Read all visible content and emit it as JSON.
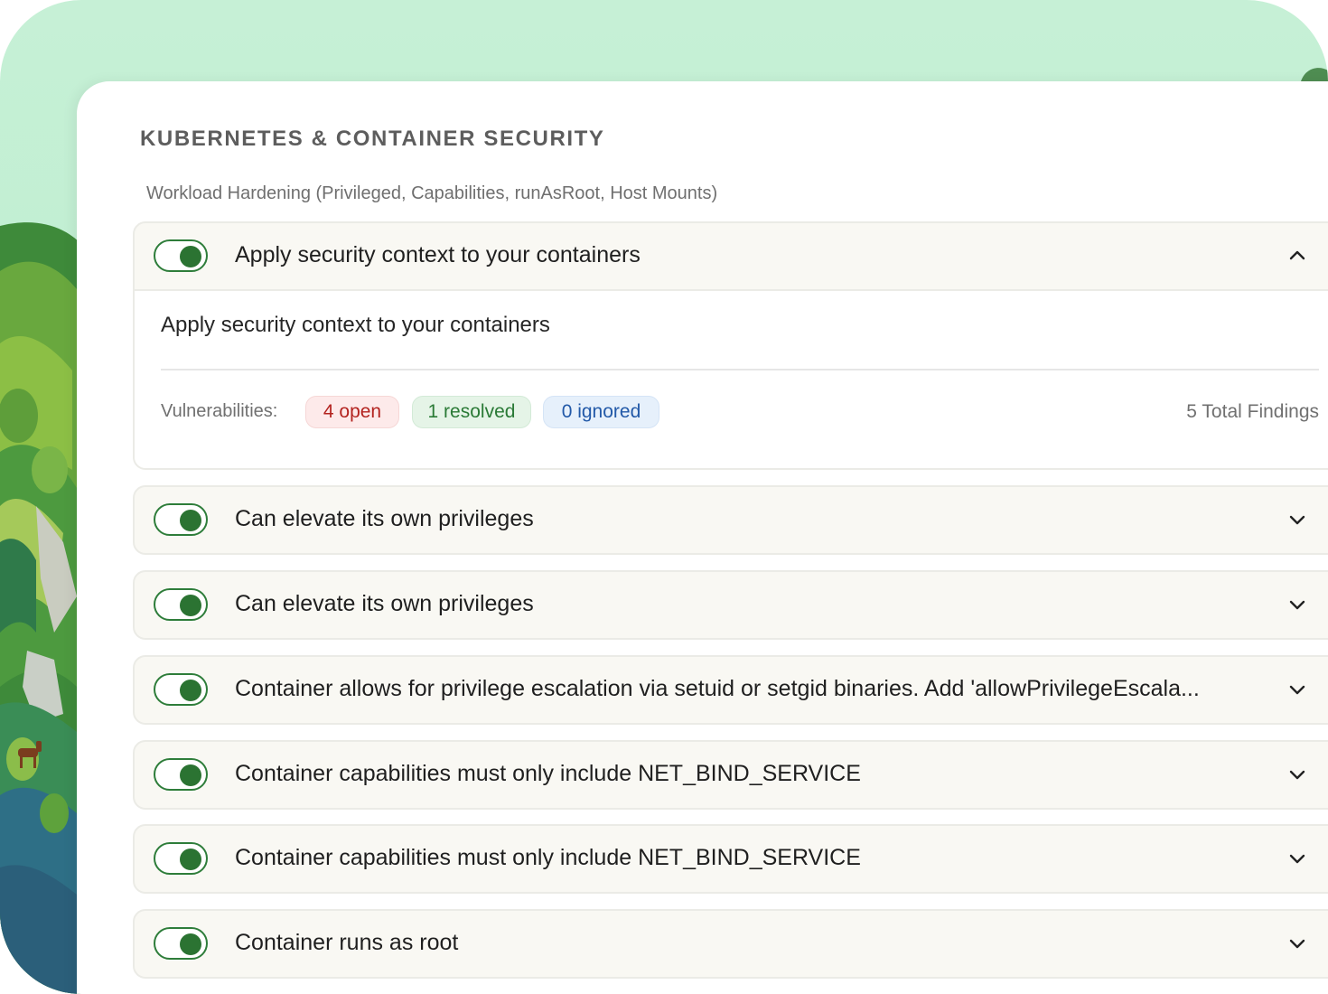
{
  "section": {
    "title": "KUBERNETES & CONTAINER SECURITY",
    "subtitle": "Workload Hardening (Privileged, Capabilities, runAsRoot, Host Mounts)"
  },
  "expanded_item": {
    "title": "Apply security context to your containers",
    "enabled": true,
    "chevron_icon": "chevron-up-icon",
    "detail_title": "Apply security context to your containers",
    "vulnerabilities_label": "Vulnerabilities:",
    "open": "4 open",
    "resolved": "1 resolved",
    "ignored": "0 ignored",
    "total": "5 Total Findings"
  },
  "items": [
    {
      "title": "Can elevate its own privileges",
      "enabled": true,
      "chevron_icon": "chevron-down-icon"
    },
    {
      "title": "Can elevate its own privileges",
      "enabled": true,
      "chevron_icon": "chevron-down-icon"
    },
    {
      "title": "Container allows for privilege escalation via setuid or setgid binaries. Add 'allowPrivilegeEscala...",
      "enabled": true,
      "chevron_icon": "chevron-down-icon"
    },
    {
      "title": "Container capabilities must only include NET_BIND_SERVICE",
      "enabled": true,
      "chevron_icon": "chevron-down-icon"
    },
    {
      "title": "Container capabilities must only include NET_BIND_SERVICE",
      "enabled": true,
      "chevron_icon": "chevron-down-icon"
    },
    {
      "title": "Container runs as root",
      "enabled": true,
      "chevron_icon": "chevron-down-icon"
    }
  ],
  "colors": {
    "toggle_on": "#2b7332",
    "open_badge_text": "#b3231f",
    "resolved_badge_text": "#2a7a36",
    "ignored_badge_text": "#2259a8"
  }
}
